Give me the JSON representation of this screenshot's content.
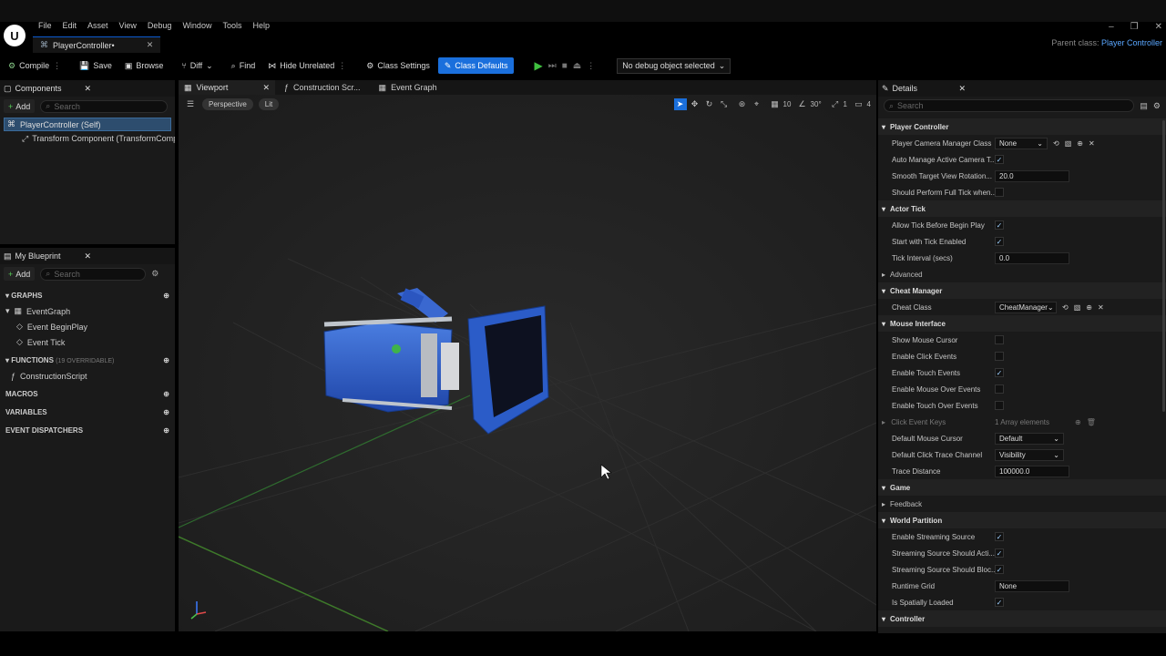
{
  "app": {
    "logo": "U"
  },
  "menu": [
    "File",
    "Edit",
    "Asset",
    "View",
    "Debug",
    "Window",
    "Tools",
    "Help"
  ],
  "doc_tab": {
    "label": "PlayerController•"
  },
  "window_controls": [
    "–",
    "❐",
    "✕"
  ],
  "parent_class": {
    "label": "Parent class:",
    "value": "Player Controller"
  },
  "toolbar": {
    "compile": "Compile",
    "save": "Save",
    "browse": "Browse",
    "diff": "Diff",
    "find": "Find",
    "hide_unrelated": "Hide Unrelated",
    "class_settings": "Class Settings",
    "class_defaults": "Class Defaults",
    "debug_select": "No debug object selected"
  },
  "components": {
    "title": "Components",
    "add": "Add",
    "search_placeholder": "Search",
    "items": [
      "PlayerController (Self)",
      "Transform Component (TransformComp"
    ]
  },
  "my_blueprint": {
    "title": "My Blueprint",
    "add": "Add",
    "search_placeholder": "Search",
    "graphs_label": "GRAPHS",
    "graph": "EventGraph",
    "events": [
      "Event BeginPlay",
      "Event Tick"
    ],
    "functions_label": "FUNCTIONS",
    "functions_count": "(19 OVERRIDABLE)",
    "construction": "ConstructionScript",
    "macros": "MACROS",
    "variables": "VARIABLES",
    "dispatchers": "EVENT DISPATCHERS"
  },
  "center_tabs": {
    "viewport": "Viewport",
    "construction": "Construction Scr...",
    "event_graph": "Event Graph"
  },
  "viewport": {
    "perspective": "Perspective",
    "lit": "Lit",
    "grid": "10",
    "angle": "30°",
    "scale": "1",
    "camera_speed": "4"
  },
  "details": {
    "title": "Details",
    "search_placeholder": "Search",
    "player_controller": {
      "header": "Player Controller",
      "camera_manager_label": "Player Camera Manager Class",
      "camera_manager_value": "None",
      "auto_manage_label": "Auto Manage Active Camera T...",
      "smooth_label": "Smooth Target View Rotation...",
      "smooth_value": "20.0",
      "full_tick_label": "Should Perform Full Tick when..."
    },
    "actor_tick": {
      "header": "Actor Tick",
      "allow_label": "Allow Tick Before Begin Play",
      "start_label": "Start with Tick Enabled",
      "interval_label": "Tick Interval (secs)",
      "interval_value": "0.0",
      "advanced": "Advanced"
    },
    "cheat": {
      "header": "Cheat Manager",
      "class_label": "Cheat Class",
      "class_value": "CheatManager"
    },
    "mouse": {
      "header": "Mouse Interface",
      "show_cursor": "Show Mouse Cursor",
      "click_events": "Enable Click Events",
      "touch_events": "Enable Touch Events",
      "mouse_over": "Enable Mouse Over Events",
      "touch_over": "Enable Touch Over Events",
      "click_keys": "Click Event Keys",
      "click_keys_value": "1 Array elements",
      "default_cursor": "Default Mouse Cursor",
      "default_cursor_value": "Default",
      "trace_channel": "Default Click Trace Channel",
      "trace_channel_value": "Visibility",
      "trace_distance": "Trace Distance",
      "trace_distance_value": "100000.0"
    },
    "game": {
      "header": "Game",
      "feedback": "Feedback"
    },
    "world": {
      "header": "World Partition",
      "enable_streaming": "Enable Streaming Source",
      "streaming_act": "Streaming Source Should Acti...",
      "streaming_bloc": "Streaming Source Should Bloc...",
      "runtime_grid": "Runtime Grid",
      "runtime_grid_value": "None",
      "spatially": "Is Spatially Loaded"
    },
    "controller": {
      "header": "Controller"
    }
  },
  "colors": {
    "accent": "#1a6fdc",
    "link": "#5aa7ff",
    "play": "#3fbf3f"
  }
}
